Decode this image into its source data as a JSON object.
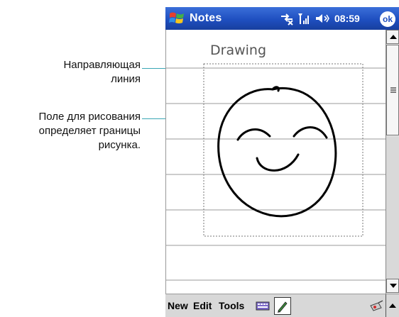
{
  "callouts": {
    "guide_line": [
      "Направляющая",
      "линия"
    ],
    "drawing_box": [
      "Поле для рисования",
      "определяет границы",
      "рисунка."
    ]
  },
  "titlebar": {
    "title": "Notes",
    "time": "08:59",
    "ok_label": "ok",
    "color": "#1f4fc0"
  },
  "note": {
    "drawing_label": "Drawing"
  },
  "menu": {
    "items": [
      "New",
      "Edit",
      "Tools"
    ]
  },
  "icons": {
    "start": "windows-flag-icon",
    "connectivity": "connectivity-x-icon",
    "signal": "signal-bars-icon",
    "volume": "speaker-icon",
    "keyboard": "keyboard-icon",
    "pen": "pen-icon",
    "recorder": "recorder-icon"
  },
  "colors": {
    "accent": "#3aa7b5",
    "guide_line": "#9a9a9a",
    "ink": "#000000"
  }
}
